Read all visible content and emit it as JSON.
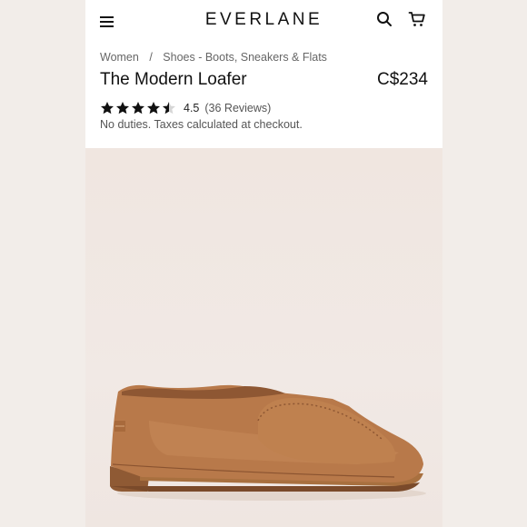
{
  "header": {
    "logo": "EVERLANE",
    "menu_icon": "hamburger-menu-icon",
    "search_icon": "search-icon",
    "cart_icon": "cart-icon"
  },
  "breadcrumb": {
    "items": [
      "Women",
      "Shoes - Boots, Sneakers & Flats"
    ],
    "separator": "/"
  },
  "product": {
    "title": "The Modern Loafer",
    "price": "C$234",
    "rating": {
      "score": "4.5",
      "stars_value": 4.5,
      "stars_max": 5,
      "reviews_label": "(36 Reviews)"
    },
    "note": "No duties. Taxes calculated at checkout.",
    "image_subject": "tan-leather-loafer"
  },
  "colors": {
    "star": "#111111",
    "image_background": "#f0e6e0",
    "leather": "#b8794a"
  }
}
